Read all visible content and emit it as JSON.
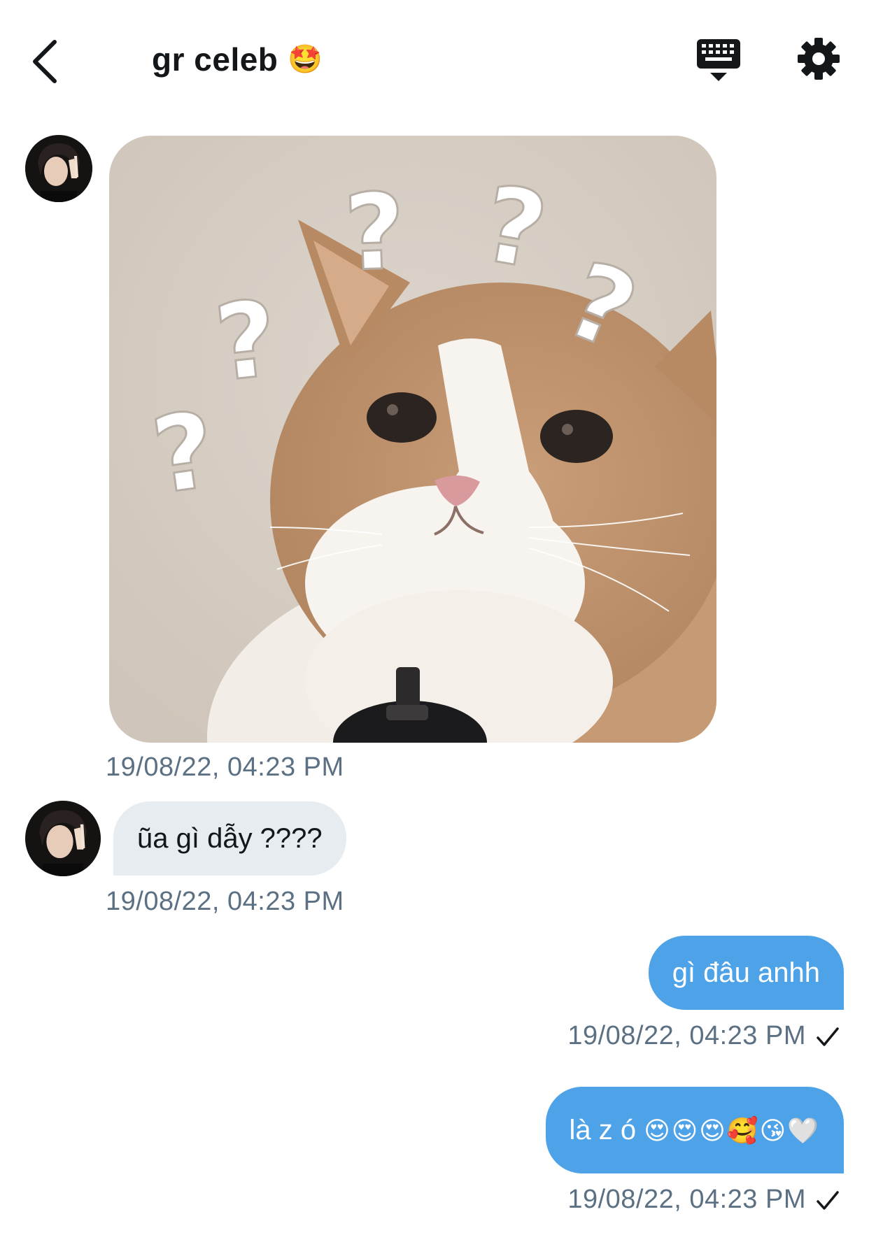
{
  "header": {
    "title": "gr celeb",
    "title_emoji": "🤩",
    "back_icon": "chevron-left-icon",
    "keyboard_icon": "keyboard-icon",
    "settings_icon": "gear-icon"
  },
  "messages": [
    {
      "type": "image",
      "direction": "incoming",
      "image_description": "cat with question marks",
      "timestamp": "19/08/22, 04:23 PM"
    },
    {
      "type": "text",
      "direction": "incoming",
      "text": "ũa gì dẫy ????",
      "timestamp": "19/08/22, 04:23 PM"
    },
    {
      "type": "text",
      "direction": "outgoing",
      "text": "gì đâu anhh",
      "timestamp": "19/08/22, 04:23 PM",
      "status_icon": "checkmark-icon"
    },
    {
      "type": "text",
      "direction": "outgoing",
      "text": "là z ó",
      "emoji": "😍😍😍🥰😘🤍",
      "timestamp": "19/08/22, 04:23 PM",
      "status_icon": "checkmark-icon"
    }
  ],
  "colors": {
    "outgoing_bubble": "#4da2e8",
    "incoming_bubble": "#e6ecf0",
    "timestamp": "#5b7083",
    "text": "#14171a"
  }
}
